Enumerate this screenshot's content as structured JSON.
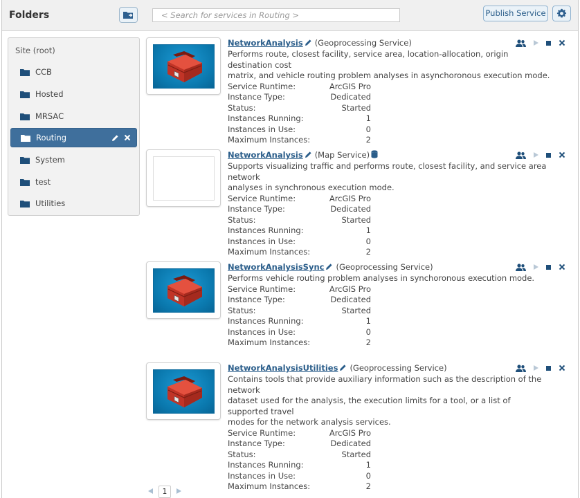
{
  "header": {
    "title": "Folders",
    "search_placeholder": "< Search for services in Routing >",
    "publish_label": "Publish Service"
  },
  "sidebar": {
    "root_label": "Site (root)",
    "folders": [
      {
        "label": "CCB"
      },
      {
        "label": "Hosted"
      },
      {
        "label": "MRSAC"
      },
      {
        "label": "Routing",
        "selected": true
      },
      {
        "label": "System"
      },
      {
        "label": "test"
      },
      {
        "label": "Utilities"
      }
    ]
  },
  "services": [
    {
      "name": "NetworkAnalysis",
      "type": "(Geoprocessing Service)",
      "desc_lines": [
        "Performs route, closest facility, service area, location-allocation, origin destination cost",
        "matrix, and vehicle routing problem analyses in asynchoronous execution mode."
      ],
      "thumbnail": "toolbox",
      "props": [
        {
          "k": "Service Runtime:",
          "v": "ArcGIS Pro"
        },
        {
          "k": "Instance Type:",
          "v": "Dedicated"
        },
        {
          "k": "Status:",
          "v": "Started"
        },
        {
          "k": "Instances Running:",
          "v": "1"
        },
        {
          "k": "Instances in Use:",
          "v": "0"
        },
        {
          "k": "Maximum Instances:",
          "v": "2"
        }
      ]
    },
    {
      "name": "NetworkAnalysis",
      "type": "(Map Service)",
      "desc_lines": [
        "Supports visualizing traffic and performs route, closest facility, and service area network",
        "analyses in synchronous execution mode."
      ],
      "thumbnail": "blank",
      "props": [
        {
          "k": "Service Runtime:",
          "v": "ArcGIS Pro"
        },
        {
          "k": "Instance Type:",
          "v": "Dedicated"
        },
        {
          "k": "Status:",
          "v": "Started"
        },
        {
          "k": "Instances Running:",
          "v": "1"
        },
        {
          "k": "Instances in Use:",
          "v": "0"
        },
        {
          "k": "Maximum Instances:",
          "v": "2"
        }
      ]
    },
    {
      "name": "NetworkAnalysisSync",
      "type": "(Geoprocessing Service)",
      "desc_lines": [
        "Performs vehicle routing problem analyses in synchoronous execution mode."
      ],
      "thumbnail": "toolbox",
      "props": [
        {
          "k": "Service Runtime:",
          "v": "ArcGIS Pro"
        },
        {
          "k": "Instance Type:",
          "v": "Dedicated"
        },
        {
          "k": "Status:",
          "v": "Started"
        },
        {
          "k": "Instances Running:",
          "v": "1"
        },
        {
          "k": "Instances in Use:",
          "v": "0"
        },
        {
          "k": "Maximum Instances:",
          "v": "2"
        }
      ]
    },
    {
      "name": "NetworkAnalysisUtilities",
      "type": "(Geoprocessing Service)",
      "desc_lines": [
        "Contains tools that provide auxiliary information such as the description of the network",
        "dataset used for the analysis, the execution limits for a tool, or a list of supported travel",
        "modes for the network analysis services."
      ],
      "thumbnail": "toolbox",
      "props": [
        {
          "k": "Service Runtime:",
          "v": "ArcGIS Pro"
        },
        {
          "k": "Instance Type:",
          "v": "Dedicated"
        },
        {
          "k": "Status:",
          "v": "Started"
        },
        {
          "k": "Instances Running:",
          "v": "1"
        },
        {
          "k": "Instances in Use:",
          "v": "0"
        },
        {
          "k": "Maximum Instances:",
          "v": "2"
        }
      ]
    }
  ],
  "pagination": {
    "current": "1"
  },
  "colors": {
    "accent": "#2a5d8a",
    "selected_folder": "#3f6f9c",
    "header_bg": "#f0f0f0"
  }
}
